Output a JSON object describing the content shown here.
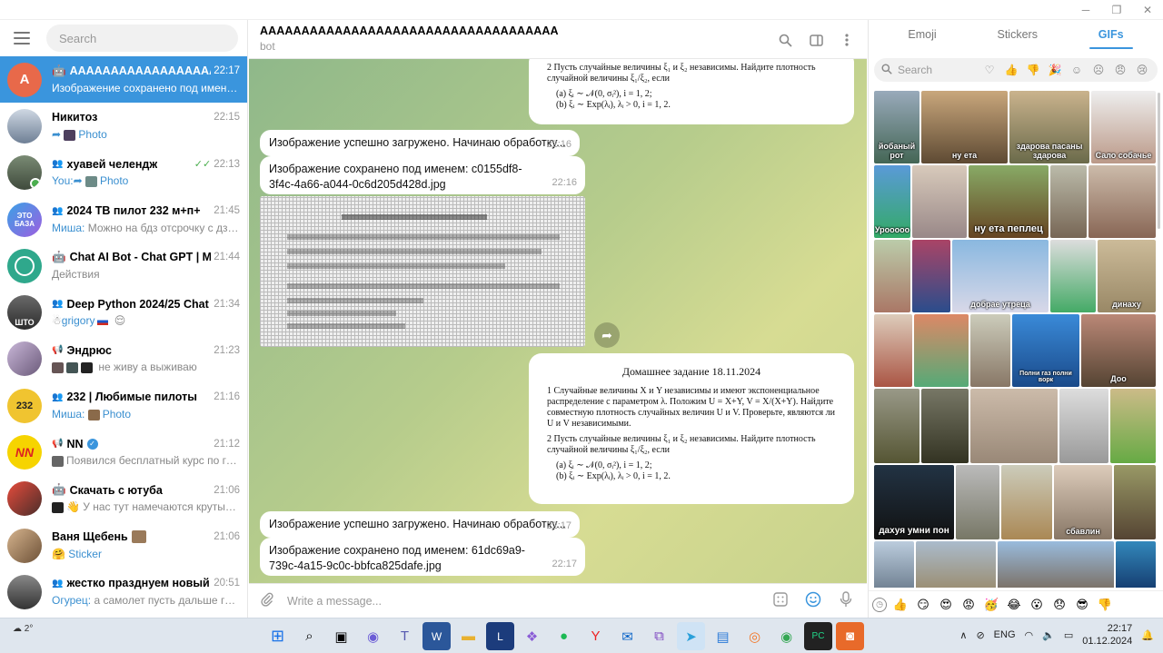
{
  "window": {
    "minimize": "─",
    "maximize": "❐",
    "close": "✕"
  },
  "sidebar": {
    "search_placeholder": "Search",
    "chats": [
      {
        "name": "AAAAAAAAAAAAAAAAAAAAA...",
        "time": "22:17",
        "sender": "",
        "preview": "Изображение сохранено под именем:...",
        "avatar_letter": "A",
        "avatar_color": "#e8694a",
        "active": true,
        "bot": true
      },
      {
        "name": "Никитоз",
        "time": "22:15",
        "sender": "",
        "preview": "Photo",
        "avatar_color": "#7b8ba0",
        "forward": true
      },
      {
        "name": "хуавей челендж",
        "time": "22:13",
        "sender": "You:",
        "preview": "Photo",
        "avatar_color": "#5d6b5a",
        "group": true,
        "read": true,
        "forward": true
      },
      {
        "name": "2024 ТВ пилот 232 м+п+",
        "time": "21:45",
        "sender": "Миша:",
        "preview": "Можно на бдз отсрочку с дз пр...",
        "avatar_color": "#3aa1e6",
        "group": true,
        "avatar_text": "ЭТО БАЗА"
      },
      {
        "name": "Chat AI Bot - Chat GPT | Midjo...",
        "time": "21:44",
        "sender": "",
        "preview": "Действия",
        "avatar_color": "#2fa88c",
        "bot": true
      },
      {
        "name": "Deep Python 2024/25 Chat",
        "time": "21:34",
        "sender": "grigory",
        "preview": "😌",
        "avatar_color": "#4b4b4b",
        "group": true,
        "avatar_text": "ШТО"
      },
      {
        "name": "Эндрюс",
        "time": "21:23",
        "sender": "",
        "preview": "не живу а выживаю",
        "avatar_color": "#8a7d9a",
        "channel": true
      },
      {
        "name": "232 | Любимые пилоты",
        "time": "21:16",
        "sender": "Миша:",
        "preview": "Photo",
        "avatar_color": "#f0c430",
        "group": true,
        "avatar_text": "232"
      },
      {
        "name": "NN",
        "time": "21:12",
        "sender": "",
        "preview": "Появился бесплатный курс по ген...",
        "avatar_color": "#f6d400",
        "channel": true,
        "verified": true,
        "avatar_text": "NN"
      },
      {
        "name": "Скачать с ютуба",
        "time": "21:06",
        "sender": "",
        "preview": "👋 У нас тут намечаются крутые о...",
        "avatar_color": "#c0392b",
        "bot": true
      },
      {
        "name": "Ваня Щебень",
        "time": "21:06",
        "sender": "",
        "preview": "Sticker",
        "avatar_color": "#a08060"
      },
      {
        "name": "жестко празднуем новый год",
        "time": "20:51",
        "sender": "Огурец:",
        "preview": "а самолет пусть дальше горит",
        "avatar_color": "#555",
        "group": true
      }
    ]
  },
  "chat": {
    "title": "AAAAAAAAAAAAAAAAAAAAAAAAAAAAAAAAAAAA",
    "subtitle": "bot",
    "messages": {
      "m1": {
        "text": "Изображение успешно загружено. Начинаю обработку...",
        "time": "22:16"
      },
      "m2": {
        "text": "Изображение сохранено под именем: c0155df8-3f4c-4a66-a044-0c6d205d428d.jpg",
        "time": "22:16"
      },
      "m3": {
        "text": "Изображение успешно загружено. Начинаю обработку...",
        "time": "22:17"
      },
      "m4": {
        "text": "Изображение сохранено под именем: 61dc69a9-739c-4a15-9c0c-bbfca825dafe.jpg",
        "time": "22:17"
      }
    },
    "doc_top": {
      "item2": "2  Пусть случайные величины ξ₁ и ξ₂ независимы. Найдите плотность случайной величины ξ₁/ξ₂, если",
      "a": "(a)  ξᵢ ∼ 𝒩(0, σᵢ²), i = 1, 2;",
      "b": "(b)  ξᵢ ∼ Exp(λᵢ), λᵢ > 0, i = 1, 2."
    },
    "doc": {
      "heading": "Домашнее задание 18.11.2024",
      "item1": "1  Случайные величины X и Y независимы и имеют экспоненциальное распределение с параметром λ. Положим U = X+Y, V = X/(X+Y). Найдите совместную плотность случайных величин U и V. Проверьте, являются ли U и V независимыми.",
      "item2": "2  Пусть случайные величины ξ₁ и ξ₂ независимы. Найдите плотность случайной величины ξ₁/ξ₂, если",
      "a": "(a)  ξᵢ ∼ 𝒩(0, σᵢ²), i = 1, 2;",
      "b": "(b)  ξᵢ ∼ Exp(λᵢ), λᵢ > 0, i = 1, 2."
    },
    "composer_placeholder": "Write a message..."
  },
  "gifs_panel": {
    "tabs": [
      "Emoji",
      "Stickers",
      "GIFs"
    ],
    "active_tab": "GIFs",
    "search_placeholder": "Search",
    "captions": {
      "g1": "йобаный рот",
      "g2": "ну ета",
      "g3": "здарова пасаны здарова",
      "g4": "Сало собачье",
      "g5": "ну ета пеплец",
      "g6": "Урооооо",
      "g7": "добрае утреца",
      "g8": "динаху",
      "g9": "Полни газ полни ворк",
      "g10": "Доо",
      "g11": "дахуя умни пон",
      "g12": "сбавлин"
    }
  },
  "taskbar": {
    "weather": "2°",
    "lang": "ENG",
    "time": "22:17",
    "date": "01.12.2024"
  }
}
